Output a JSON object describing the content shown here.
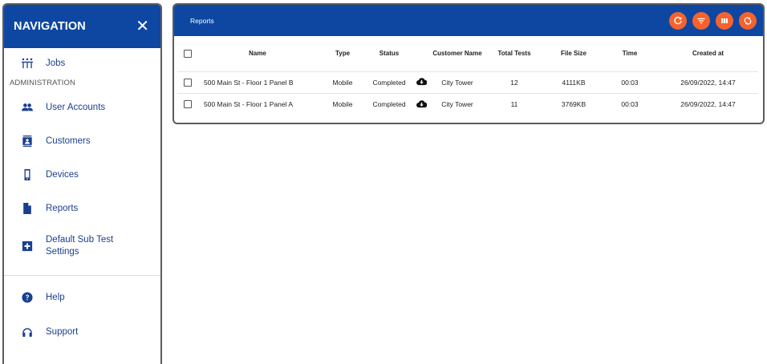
{
  "nav": {
    "title": "NAVIGATION",
    "close": "✕",
    "jobs": "Jobs",
    "section_admin": "ADMINISTRATION",
    "items": [
      {
        "label": "User Accounts",
        "icon": "users-icon"
      },
      {
        "label": "Customers",
        "icon": "contact-card-icon"
      },
      {
        "label": "Devices",
        "icon": "phone-icon"
      },
      {
        "label": "Reports",
        "icon": "document-icon"
      },
      {
        "label_line1": "Default Sub Test",
        "label_line2": "Settings",
        "icon": "medical-box-icon"
      }
    ],
    "help": "Help",
    "support": "Support"
  },
  "reports": {
    "title": "Reports",
    "actions": [
      "refresh-icon",
      "filter-icon",
      "columns-icon",
      "sync-icon"
    ],
    "columns": [
      "Name",
      "Type",
      "Status",
      "Customer Name",
      "Total Tests",
      "File Size",
      "Time",
      "Created at"
    ],
    "rows": [
      {
        "name": "500 Main St - Floor 1 Panel B",
        "type": "Mobile",
        "status": "Completed",
        "customer": "City Tower",
        "tests": "12",
        "size": "4111KB",
        "time": "00:03",
        "created": "26/09/2022, 14:47"
      },
      {
        "name": "500 Main St - Floor 1 Panel A",
        "type": "Mobile",
        "status": "Completed",
        "customer": "City Tower",
        "tests": "11",
        "size": "3769KB",
        "time": "00:03",
        "created": "26/09/2022, 14:47"
      }
    ]
  },
  "colors": {
    "primary": "#0d47a1",
    "accent": "#f4632e",
    "nav_text": "#1a3f8f"
  }
}
